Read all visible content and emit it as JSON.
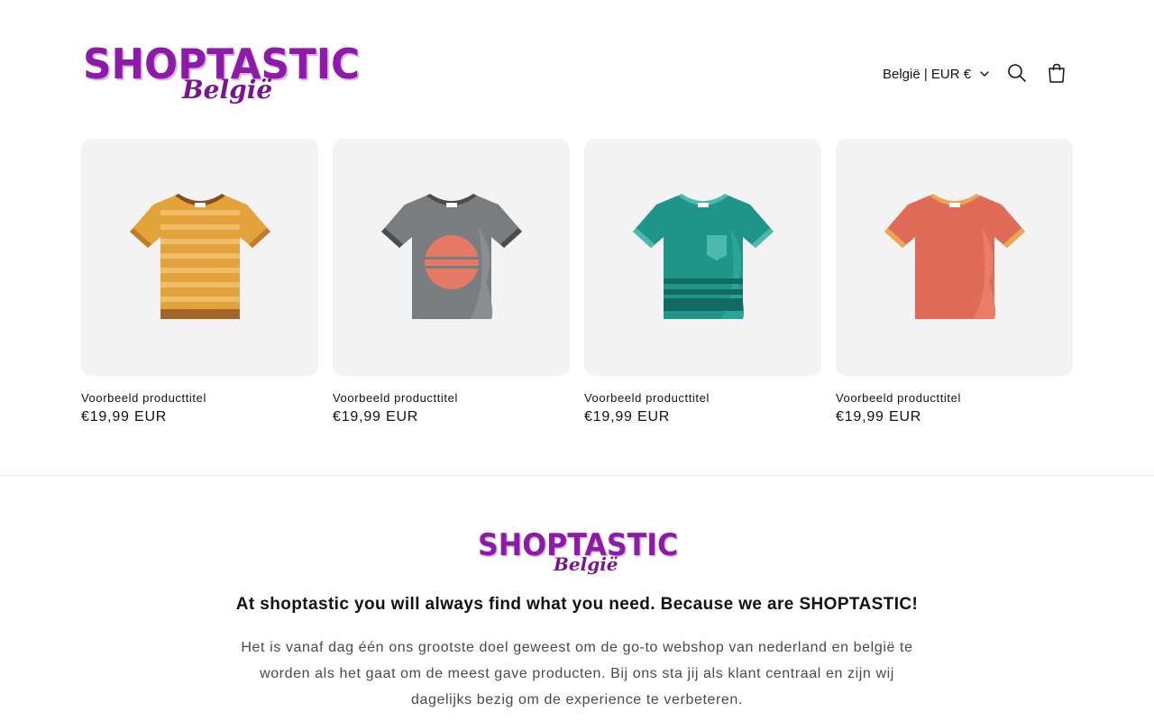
{
  "header": {
    "logo_text": "SHOPTASTIC",
    "logo_sub": "België",
    "country_selector": "België | EUR €",
    "icons": {
      "search": "search-icon",
      "cart": "cart-icon",
      "chevron": "chevron-down-icon"
    }
  },
  "products": [
    {
      "title": "Voorbeeld producttitel",
      "price": "€19,99 EUR",
      "image": "orange-striped-tshirt"
    },
    {
      "title": "Voorbeeld producttitel",
      "price": "€19,99 EUR",
      "image": "grey-sunset-tshirt"
    },
    {
      "title": "Voorbeeld producttitel",
      "price": "€19,99 EUR",
      "image": "teal-pocket-tshirt"
    },
    {
      "title": "Voorbeeld producttitel",
      "price": "€19,99 EUR",
      "image": "coral-tshirt"
    }
  ],
  "footer": {
    "logo_text": "SHOPTASTIC",
    "logo_sub": "België",
    "headline": "At shoptastic you will always find what you need. Because we are SHOPTASTIC!",
    "body": "Het is vanaf dag één ons grootste doel geweest om de go-to webshop van nederland en belgië te worden als het gaat om de meest gave producten. Bij ons sta jij als klant centraal en zijn wij dagelijks bezig om de experience te verbeteren."
  },
  "colors": {
    "brand_purple": "#8e1aa8",
    "card_bg": "#f3f3f3",
    "text": "#121212",
    "muted_text": "#4a4a4a"
  }
}
